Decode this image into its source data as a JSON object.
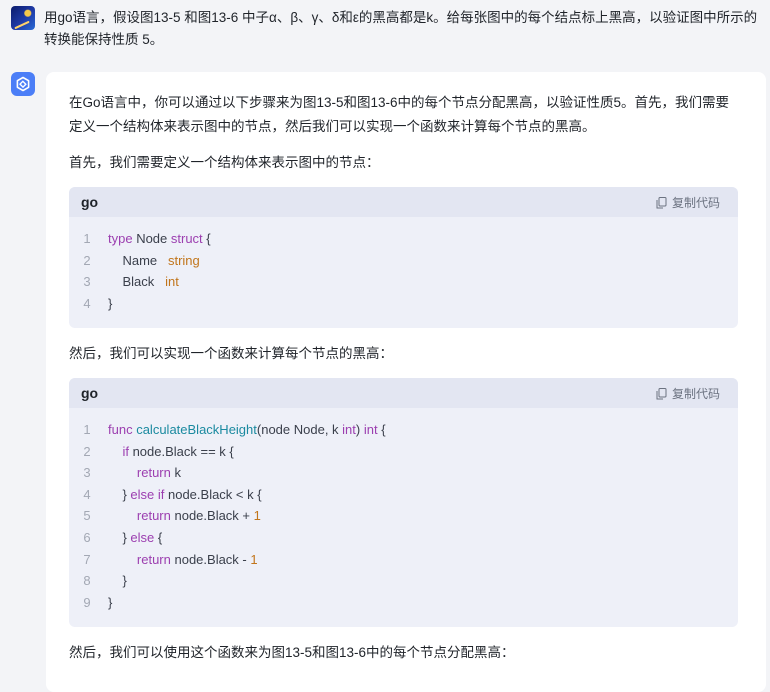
{
  "user_message": {
    "line1": "用go语言，假设图13-5 和图13-6 中子α、β、γ、δ和ε的黑高都是k。给每张图中的每个结点标上黑高，以验证图中所示的",
    "line2": "转换能保持性质 5。"
  },
  "assistant": {
    "para1_line1": "在Go语言中，你可以通过以下步骤来为图13-5和图13-6中的每个节点分配黑高，以验证性质5。首先，我们需要",
    "para1_line2": "定义一个结构体来表示图中的节点，然后我们可以实现一个函数来计算每个节点的黑高。",
    "para2": "首先，我们需要定义一个结构体来表示图中的节点：",
    "para3": "然后，我们可以实现一个函数来计算每个节点的黑高：",
    "para4": "然后，我们可以使用这个函数来为图13-5和图13-6中的每个节点分配黑高："
  },
  "code_block_1": {
    "lang": "go",
    "copy_label": "复制代码",
    "lines": [
      {
        "n": "1",
        "tokens": [
          [
            "kw",
            "type"
          ],
          [
            "p",
            " Node "
          ],
          [
            "kw",
            "struct"
          ],
          [
            "p",
            " {"
          ]
        ]
      },
      {
        "n": "2",
        "tokens": [
          [
            "p",
            "    Name   "
          ],
          [
            "ty",
            "string"
          ]
        ]
      },
      {
        "n": "3",
        "tokens": [
          [
            "p",
            "    Black   "
          ],
          [
            "ty",
            "int"
          ]
        ]
      },
      {
        "n": "4",
        "tokens": [
          [
            "p",
            "}"
          ]
        ]
      }
    ]
  },
  "code_block_2": {
    "lang": "go",
    "copy_label": "复制代码",
    "lines": [
      {
        "n": "1",
        "tokens": [
          [
            "kw",
            "func"
          ],
          [
            "p",
            " "
          ],
          [
            "fn",
            "calculateBlackHeight"
          ],
          [
            "p",
            "(node Node, k "
          ],
          [
            "kw",
            "int"
          ],
          [
            "p",
            ") "
          ],
          [
            "kw",
            "int"
          ],
          [
            "p",
            " {"
          ]
        ]
      },
      {
        "n": "2",
        "tokens": [
          [
            "p",
            "    "
          ],
          [
            "kw",
            "if"
          ],
          [
            "p",
            " node.Black == k {"
          ]
        ]
      },
      {
        "n": "3",
        "tokens": [
          [
            "p",
            "        "
          ],
          [
            "kw",
            "return"
          ],
          [
            "p",
            " k"
          ]
        ]
      },
      {
        "n": "4",
        "tokens": [
          [
            "p",
            "    } "
          ],
          [
            "kw",
            "else if"
          ],
          [
            "p",
            " node.Black < k {"
          ]
        ]
      },
      {
        "n": "5",
        "tokens": [
          [
            "p",
            "        "
          ],
          [
            "kw",
            "return"
          ],
          [
            "p",
            " node.Black + "
          ],
          [
            "num",
            "1"
          ]
        ]
      },
      {
        "n": "6",
        "tokens": [
          [
            "p",
            "    } "
          ],
          [
            "kw",
            "else"
          ],
          [
            "p",
            " {"
          ]
        ]
      },
      {
        "n": "7",
        "tokens": [
          [
            "p",
            "        "
          ],
          [
            "kw",
            "return"
          ],
          [
            "p",
            " node.Black - "
          ],
          [
            "num",
            "1"
          ]
        ]
      },
      {
        "n": "8",
        "tokens": [
          [
            "p",
            "    }"
          ]
        ]
      },
      {
        "n": "9",
        "tokens": [
          [
            "p",
            "}"
          ]
        ]
      }
    ]
  },
  "colors": {
    "keyword": "#9c3fb0",
    "type": "#c1751b",
    "function": "#1b8aa0",
    "accent": "#4b7ef7"
  },
  "icons": [
    "user-avatar",
    "assistant-logo-icon",
    "copy-icon"
  ]
}
